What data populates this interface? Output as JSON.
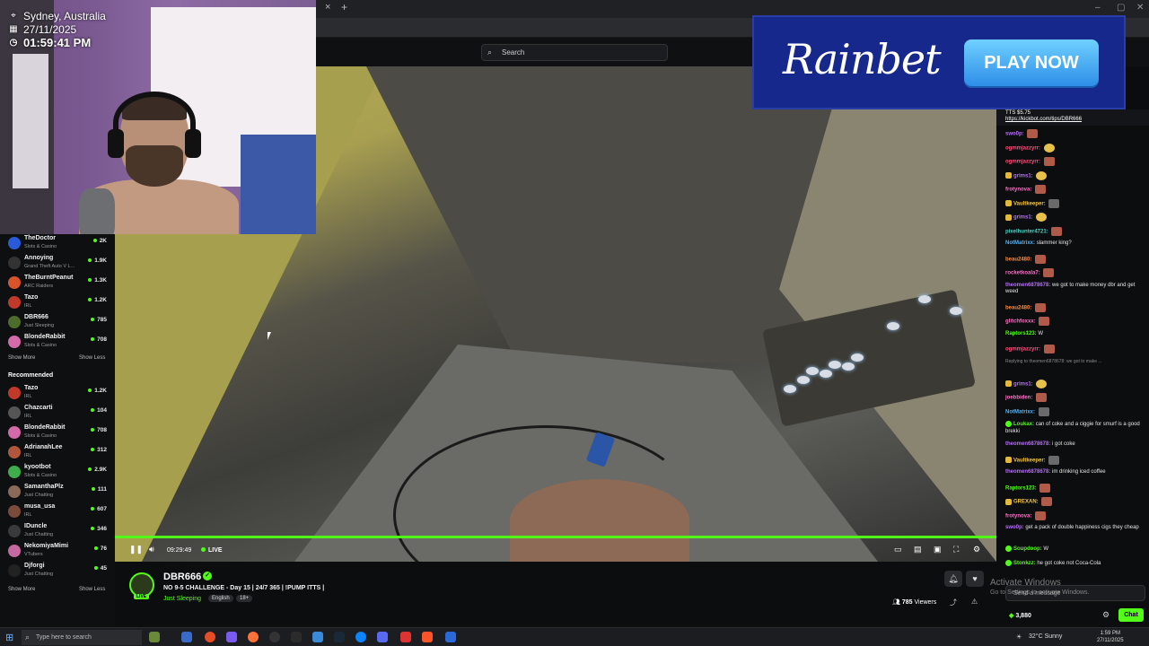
{
  "browser": {
    "search_placeholder": "Search",
    "close_tab": "×",
    "new_tab": "+",
    "window_controls": [
      "–",
      "▢",
      "✕"
    ]
  },
  "overlay": {
    "location": "Sydney, Australia",
    "date": "27/11/2025",
    "time": "01:59:41 PM"
  },
  "sidebar": {
    "following": [
      {
        "name": "TheDoctor",
        "category": "Slots & Casino",
        "viewers": "2K",
        "color": "#2a5bd7"
      },
      {
        "name": "Annoying",
        "category": "Grand Theft Auto V L...",
        "viewers": "1.9K",
        "color": "#333333"
      },
      {
        "name": "TheBurntPeanut",
        "category": "ARC Raiders",
        "viewers": "1.3K",
        "color": "#d9532b"
      },
      {
        "name": "Tazo",
        "category": "IRL",
        "viewers": "1.2K",
        "color": "#c0392b"
      },
      {
        "name": "DBR666",
        "category": "Just Sleeping",
        "viewers": "785",
        "color": "#4d6b2a"
      },
      {
        "name": "BlondeRabbit",
        "category": "Slots & Casino",
        "viewers": "708",
        "color": "#d46aa8"
      }
    ],
    "show_more": "Show More",
    "show_less": "Show Less",
    "recommended_heading": "Recommended",
    "recommended": [
      {
        "name": "Tazo",
        "category": "IRL",
        "viewers": "1.2K",
        "color": "#c0392b"
      },
      {
        "name": "Chazcarti",
        "category": "IRL",
        "viewers": "104",
        "color": "#555555"
      },
      {
        "name": "BlondeRabbit",
        "category": "Slots & Casino",
        "viewers": "708",
        "color": "#d46aa8"
      },
      {
        "name": "AdrianahLee",
        "category": "IRL",
        "viewers": "312",
        "color": "#b0563a"
      },
      {
        "name": "kyootbot",
        "category": "Slots & Casino",
        "viewers": "2.9K",
        "color": "#3fae4a"
      },
      {
        "name": "SamanthaPlz",
        "category": "Just Chatting",
        "viewers": "111",
        "color": "#8a6a5a"
      },
      {
        "name": "musa_usa",
        "category": "IRL",
        "viewers": "607",
        "color": "#7a4a3a"
      },
      {
        "name": "IDuncle",
        "category": "Just Chatting",
        "viewers": "346",
        "color": "#3a3a3a"
      },
      {
        "name": "NekomiyaMimi",
        "category": "VTubers",
        "viewers": "76",
        "color": "#c46aa0"
      },
      {
        "name": "Djforgi",
        "category": "Just Chatting",
        "viewers": "45",
        "color": "#222222"
      }
    ]
  },
  "ad": {
    "brand": "Rainbet",
    "cta": "PLAY NOW"
  },
  "player": {
    "elapsed": "09:29:49",
    "live_label": "LIVE",
    "progress_fraction": 1.0
  },
  "stream": {
    "streamer": "DBR666",
    "title": "NO 9-5 CHALLENGE - Day 15 | 24/7 365 | !PUMP ITTS |",
    "category": "Just Sleeping",
    "tags": [
      "English",
      "18+"
    ],
    "viewers": "785",
    "viewers_label": "Viewers",
    "live_badge": "LIVE"
  },
  "chat": {
    "pinned_text": "TTS $5.75",
    "pinned_link": "https://kickbot.com/tips/DBR666",
    "messages": [
      {
        "user": "swo0p:",
        "text": "",
        "color": "#b86bff",
        "emote": "r"
      },
      {
        "user": "ogmmjazzyrr:",
        "text": "",
        "color": "#ff4f7b",
        "emote": "y"
      },
      {
        "user": "ogmmjazzyrr:",
        "text": "",
        "color": "#ff4f7b",
        "emote": "r"
      },
      {
        "user": "grims1:",
        "text": "",
        "color": "#b86bff",
        "emote": "y",
        "badge": "y"
      },
      {
        "user": "frotynova:",
        "text": "",
        "color": "#ff6ec7",
        "emote": "r"
      },
      {
        "user": "Vaultkeeper:",
        "text": "",
        "color": "#f5c542",
        "emote": "g",
        "badge": "y"
      },
      {
        "user": "grims1:",
        "text": "",
        "color": "#b86bff",
        "emote": "y",
        "badge": "y"
      },
      {
        "user": "pixelhunter4721:",
        "text": "",
        "color": "#4fd1c5",
        "emote": "r"
      },
      {
        "user": "NotMatrixx:",
        "text": "slammer king?",
        "color": "#4fb3ff"
      },
      {
        "user": "beau2480:",
        "text": "",
        "color": "#ff8a3d",
        "emote": "r"
      },
      {
        "user": "rocketkoala7:",
        "text": "",
        "color": "#ff6ec7",
        "emote": "r"
      },
      {
        "user": "theomen6878678:",
        "text": "we got to make money dbr and get weed",
        "color": "#b86bff"
      },
      {
        "user": "beau2480:",
        "text": "",
        "color": "#ff8a3d",
        "emote": "r"
      },
      {
        "user": "glitchfoxxx:",
        "text": "",
        "color": "#ff6ec7",
        "emote": "r"
      },
      {
        "user": "Raptors123:",
        "text": "W",
        "color": "#53fc18"
      },
      {
        "user": "ogmmjazzyrr:",
        "text": "",
        "color": "#ff4f7b",
        "emote": "r"
      },
      {
        "user": "",
        "text": "Replying to theomen6878678: we got to make ...",
        "color": "#8a8a8a",
        "reply": true
      },
      {
        "user": "grims1:",
        "text": "",
        "color": "#b86bff",
        "emote": "y",
        "badge": "y"
      },
      {
        "user": "joebbiden:",
        "text": "",
        "color": "#ff6ec7",
        "emote": "r"
      },
      {
        "user": "NotMatrixx:",
        "text": "",
        "color": "#4fb3ff",
        "emote": "g"
      },
      {
        "user": "Loukax:",
        "text": "can of coke and a ciggie for smurf is a good brekki",
        "color": "#53fc18",
        "badge": "g"
      },
      {
        "user": "theomen6878678:",
        "text": "i got coke",
        "color": "#b86bff"
      },
      {
        "user": "Vaultkeeper:",
        "text": "",
        "color": "#f5c542",
        "emote": "g",
        "badge": "y"
      },
      {
        "user": "theomen6878678:",
        "text": "im drinking iced coffee",
        "color": "#b86bff"
      },
      {
        "user": "Raptors123:",
        "text": "",
        "color": "#53fc18",
        "emote": "r"
      },
      {
        "user": "GREXAN:",
        "text": "",
        "color": "#f5c542",
        "emote": "r",
        "badge": "y"
      },
      {
        "user": "frotynova:",
        "text": "",
        "color": "#ff6ec7",
        "emote": "r"
      },
      {
        "user": "swo0p:",
        "text": "get a pack of double happiness cigs they cheap",
        "color": "#b86bff"
      },
      {
        "user": "Soupdoop:",
        "text": "W",
        "color": "#53fc18",
        "badge": "g"
      },
      {
        "user": "Stonkzz:",
        "text": "he got coke not Coca-Cola",
        "color": "#53fc18",
        "badge": "g"
      }
    ],
    "input_placeholder": "Send a message",
    "points": "3,880",
    "chat_button": "Chat"
  },
  "watermark": {
    "title": "Activate Windows",
    "subtitle": "Go to Settings to activate Windows."
  },
  "taskbar": {
    "search_placeholder": "Type here to search",
    "weather": "32°C  Sunny",
    "time": "1:59 PM",
    "date": "27/11/2025"
  }
}
